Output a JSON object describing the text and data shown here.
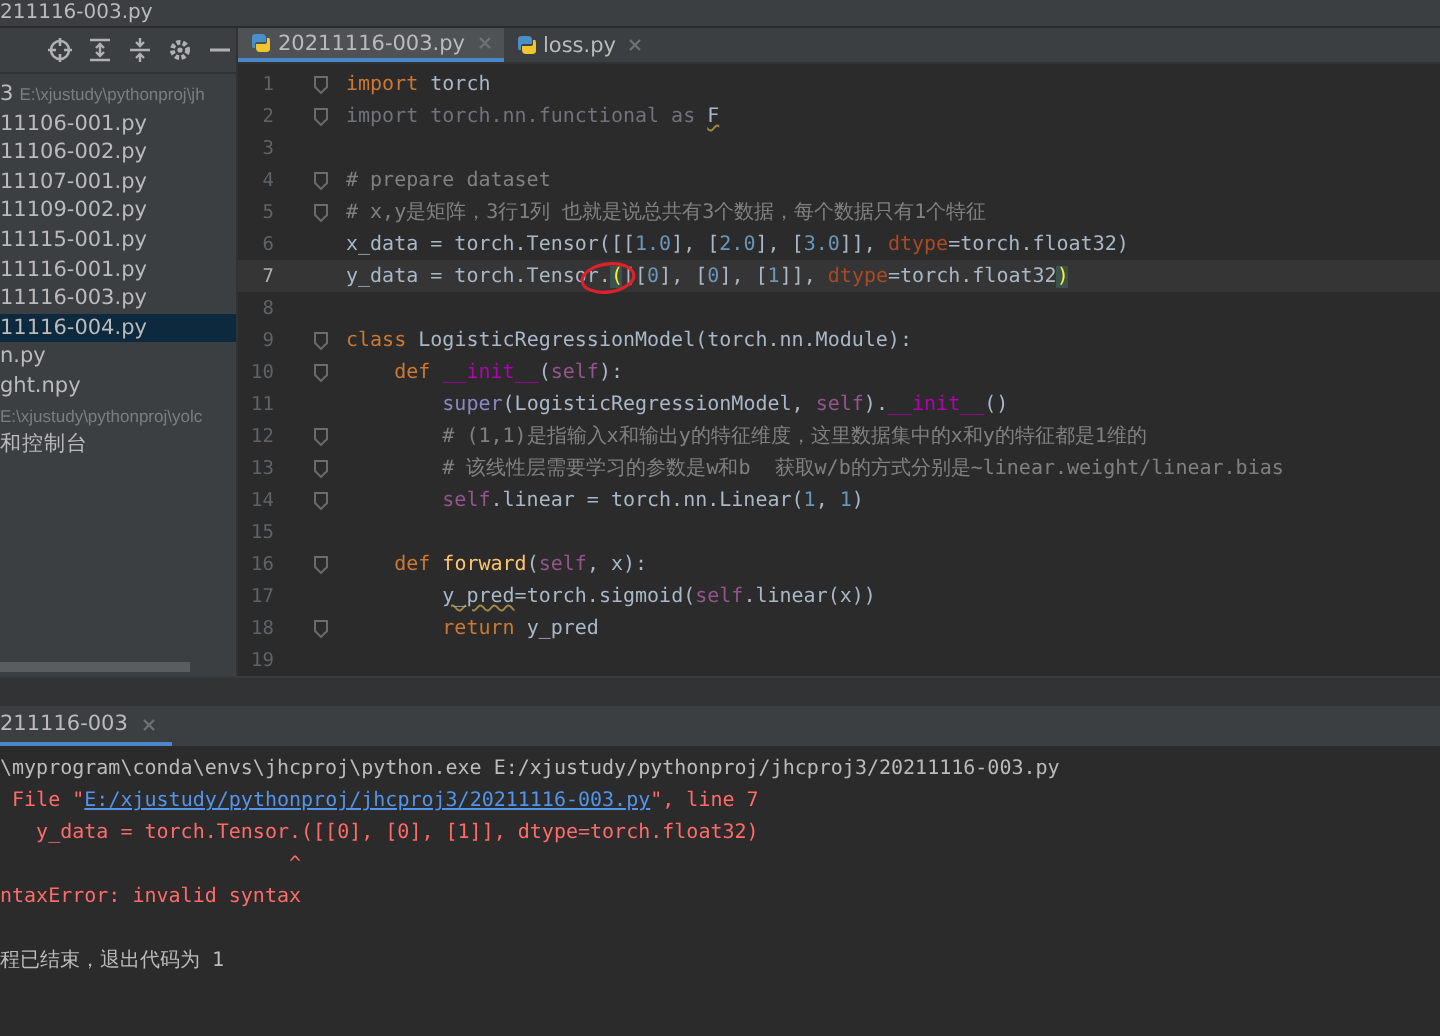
{
  "window": {
    "title": "211116-003.py"
  },
  "project_panel": {
    "items": [
      {
        "text": "3",
        "path": "E:\\xjustudy\\pythonproj\\jh",
        "selected": false
      },
      {
        "text": "11106-001.py",
        "selected": false
      },
      {
        "text": "11106-002.py",
        "selected": false
      },
      {
        "text": "11107-001.py",
        "selected": false
      },
      {
        "text": "11109-002.py",
        "selected": false
      },
      {
        "text": "11115-001.py",
        "selected": false
      },
      {
        "text": "11116-001.py",
        "selected": false
      },
      {
        "text": "11116-003.py",
        "selected": false
      },
      {
        "text": "11116-004.py",
        "selected": true
      },
      {
        "text": "n.py",
        "selected": false
      },
      {
        "text": "ght.npy",
        "selected": false
      },
      {
        "path": "E:\\xjustudy\\pythonproj\\yolc",
        "selected": false
      },
      {
        "text": "和控制台",
        "selected": false
      }
    ]
  },
  "editor_tabs": [
    {
      "label": "20211116-003.py",
      "selected": true
    },
    {
      "label": "loss.py",
      "selected": false
    }
  ],
  "code_lines": [
    {
      "number": "1",
      "current": false,
      "fold": true,
      "tokens": [
        {
          "kind": "kw",
          "text": "import"
        },
        {
          "kind": "plain",
          "text": " torch"
        }
      ]
    },
    {
      "number": "2",
      "current": false,
      "fold": true,
      "tokens": [
        {
          "kind": "unused",
          "text": "import torch.nn.functional as "
        },
        {
          "kind": "warn",
          "text": "F"
        }
      ]
    },
    {
      "number": "3",
      "current": false,
      "fold": false
    },
    {
      "number": "4",
      "current": false,
      "fold": true,
      "tokens": [
        {
          "kind": "comment",
          "text": "# prepare dataset"
        }
      ]
    },
    {
      "number": "5",
      "current": false,
      "fold": true,
      "tokens": [
        {
          "kind": "comment",
          "text": "# x,y是矩阵，3行1列 也就是说总共有3个数据，每个数据只有1个特征"
        }
      ]
    },
    {
      "number": "6",
      "current": false,
      "fold": false,
      "tokens": [
        {
          "kind": "plain",
          "text": "x_data = torch.Tensor([["
        },
        {
          "kind": "num",
          "text": "1.0"
        },
        {
          "kind": "plain",
          "text": "], ["
        },
        {
          "kind": "num",
          "text": "2.0"
        },
        {
          "kind": "plain",
          "text": "], ["
        },
        {
          "kind": "num",
          "text": "3.0"
        },
        {
          "kind": "plain",
          "text": "]], "
        },
        {
          "kind": "param",
          "text": "dtype"
        },
        {
          "kind": "plain",
          "text": "=torch.float32)"
        }
      ]
    },
    {
      "number": "7",
      "current": true,
      "fold": false,
      "tokens": [
        {
          "kind": "plain",
          "text": "y_data = torch.Tensor."
        },
        {
          "kind": "circled-match",
          "text": "("
        },
        {
          "kind": "plain",
          "text": "[["
        },
        {
          "kind": "num",
          "text": "0"
        },
        {
          "kind": "plain",
          "text": "], ["
        },
        {
          "kind": "num",
          "text": "0"
        },
        {
          "kind": "plain",
          "text": "], ["
        },
        {
          "kind": "num",
          "text": "1"
        },
        {
          "kind": "plain",
          "text": "]], "
        },
        {
          "kind": "param",
          "text": "dtype"
        },
        {
          "kind": "plain",
          "text": "=torch.float32"
        },
        {
          "kind": "match",
          "text": ")"
        }
      ]
    },
    {
      "number": "8",
      "current": false,
      "fold": false
    },
    {
      "number": "9",
      "current": false,
      "fold": true,
      "tokens": [
        {
          "kind": "kw",
          "text": "class"
        },
        {
          "kind": "plain",
          "text": " LogisticRegressionModel(torch.nn.Module):"
        }
      ]
    },
    {
      "number": "10",
      "current": false,
      "fold": true,
      "tokens": [
        {
          "kind": "kw",
          "text": "    def"
        },
        {
          "kind": "dunder",
          "text": " __init__"
        },
        {
          "kind": "plain",
          "text": "("
        },
        {
          "kind": "self",
          "text": "self"
        },
        {
          "kind": "plain",
          "text": "):"
        }
      ]
    },
    {
      "number": "11",
      "current": false,
      "fold": false,
      "tokens": [
        {
          "kind": "builtin",
          "text": "        super"
        },
        {
          "kind": "plain",
          "text": "(LogisticRegressionModel, "
        },
        {
          "kind": "self",
          "text": "self"
        },
        {
          "kind": "plain",
          "text": ")."
        },
        {
          "kind": "dunder",
          "text": "__init__"
        },
        {
          "kind": "plain",
          "text": "()"
        }
      ]
    },
    {
      "number": "12",
      "current": false,
      "fold": true,
      "tokens": [
        {
          "kind": "comment",
          "text": "        # (1,1)是指输入x和输出y的特征维度，这里数据集中的x和y的特征都是1维的"
        }
      ]
    },
    {
      "number": "13",
      "current": false,
      "fold": true,
      "tokens": [
        {
          "kind": "comment",
          "text": "        # 该线性层需要学习的参数是w和b  获取w/b的方式分别是~linear.weight/linear.bias"
        }
      ]
    },
    {
      "number": "14",
      "current": false,
      "fold": true,
      "tokens": [
        {
          "kind": "self",
          "text": "        self"
        },
        {
          "kind": "plain",
          "text": ".linear = torch.nn.Linear("
        },
        {
          "kind": "num",
          "text": "1"
        },
        {
          "kind": "plain",
          "text": ", "
        },
        {
          "kind": "num",
          "text": "1"
        },
        {
          "kind": "plain",
          "text": ")"
        }
      ]
    },
    {
      "number": "15",
      "current": false,
      "fold": false
    },
    {
      "number": "16",
      "current": false,
      "fold": true,
      "tokens": [
        {
          "kind": "kw",
          "text": "    def"
        },
        {
          "kind": "fn",
          "text": " forward"
        },
        {
          "kind": "plain",
          "text": "("
        },
        {
          "kind": "self",
          "text": "self"
        },
        {
          "kind": "plain",
          "text": ", x):"
        }
      ]
    },
    {
      "number": "17",
      "current": false,
      "fold": false,
      "tokens": [
        {
          "kind": "indent-warn",
          "text": "        y_pred"
        },
        {
          "kind": "plain",
          "text": "=torch.sigmoid("
        },
        {
          "kind": "self",
          "text": "self"
        },
        {
          "kind": "plain",
          "text": ".linear(x))"
        }
      ]
    },
    {
      "number": "18",
      "current": false,
      "fold": true,
      "tokens": [
        {
          "kind": "kw",
          "text": "        return"
        },
        {
          "kind": "plain",
          "text": " y_pred"
        }
      ]
    },
    {
      "number": "19",
      "current": false,
      "fold": false
    }
  ],
  "run_panel": {
    "tab": "211116-003",
    "lines": [
      {
        "kind": "output",
        "segments": [
          {
            "kind": "plain",
            "text": "\\myprogram\\conda\\envs\\jhcproj\\python.exe E:/xjustudy/pythonproj/jhcproj3/20211116-003.py"
          }
        ]
      },
      {
        "kind": "output",
        "segments": [
          {
            "kind": "error",
            "text": " File \""
          },
          {
            "kind": "link",
            "text": "E:/xjustudy/pythonproj/jhcproj3/20211116-003.py"
          },
          {
            "kind": "error",
            "text": "\", line 7"
          }
        ]
      },
      {
        "kind": "output",
        "segments": [
          {
            "kind": "error",
            "text": "   y_data = torch.Tensor.([[0], [0], [1]], dtype=torch.float32)"
          }
        ]
      },
      {
        "kind": "output",
        "segments": [
          {
            "kind": "error",
            "text": "                        ^"
          }
        ]
      },
      {
        "kind": "output",
        "segments": [
          {
            "kind": "error",
            "text": "ntaxError: invalid syntax"
          }
        ]
      },
      {
        "kind": "exit",
        "segments": [
          {
            "kind": "plain",
            "text": "程已结束，退出代码为 1"
          }
        ]
      }
    ]
  }
}
